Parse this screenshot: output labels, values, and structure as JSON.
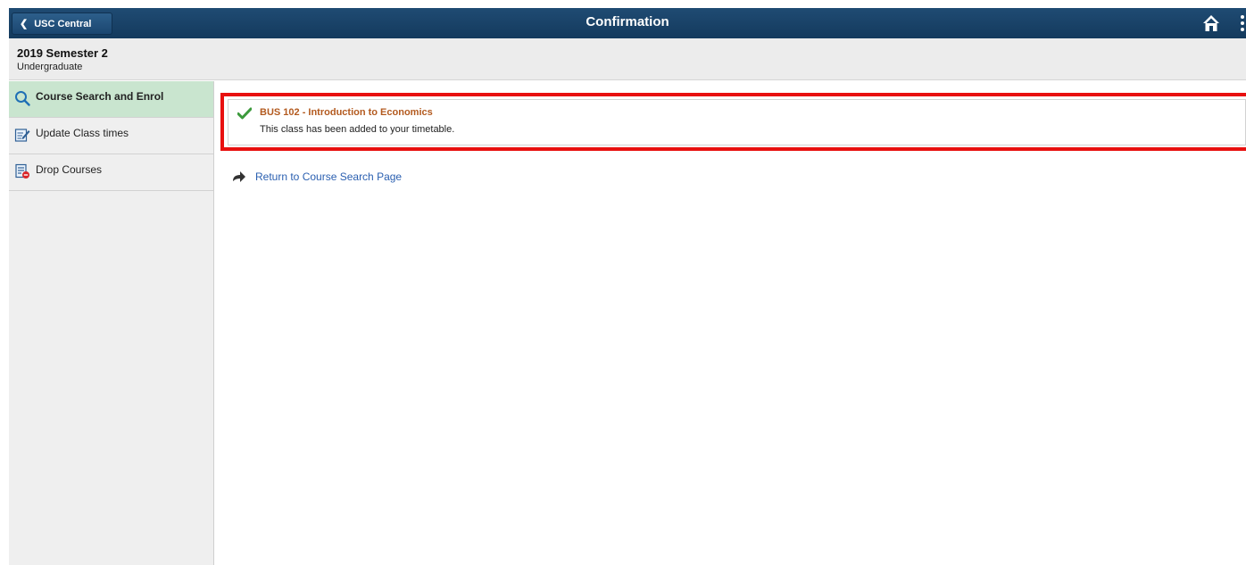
{
  "header": {
    "back_label": "USC Central",
    "title": "Confirmation",
    "home_icon": "home-icon",
    "menu_icon": "more-vertical-icon",
    "bar_color": "#1a4268"
  },
  "subheader": {
    "term": "2019 Semester 2",
    "career": "Undergraduate"
  },
  "sidebar": {
    "items": [
      {
        "label": "Course Search and Enrol",
        "icon": "search-icon",
        "active": true
      },
      {
        "label": "Update Class times",
        "icon": "edit-icon",
        "active": false
      },
      {
        "label": "Drop Courses",
        "icon": "drop-list-icon",
        "active": false
      }
    ],
    "active_color": "#c9e5cf"
  },
  "main": {
    "confirmation": {
      "course": "BUS  102 - Introduction to Economics",
      "message": "This class has been added to your timetable.",
      "status_icon": "checkmark-icon",
      "highlight_color": "#e8100f",
      "course_color": "#b35a1f"
    },
    "return_link": "Return to Course Search Page",
    "return_icon": "return-arrow-icon"
  }
}
